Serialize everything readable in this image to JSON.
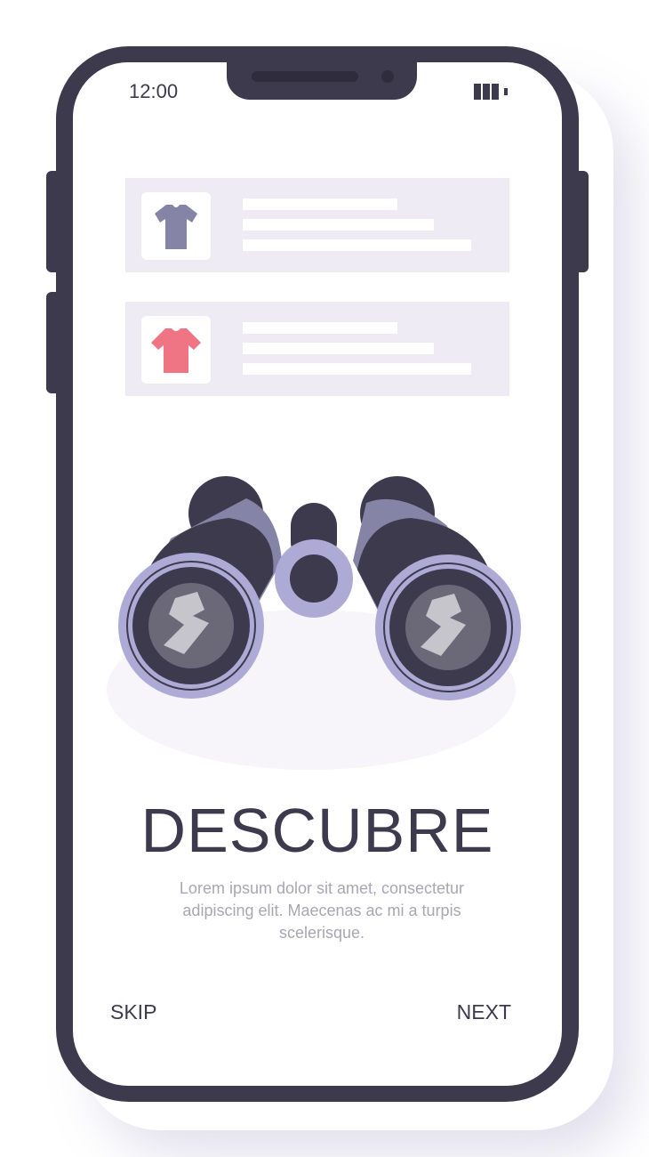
{
  "status_bar": {
    "time": "12:00",
    "battery_icon": "battery-icon"
  },
  "product_list": [
    {
      "icon": "tshirt-icon",
      "color": "#8583a6"
    },
    {
      "icon": "tshirt-icon",
      "color": "#ef7584"
    }
  ],
  "illustration": {
    "icon": "binoculars-icon"
  },
  "onboarding": {
    "title": "DESCUBRE",
    "description": "Lorem ipsum dolor sit amet, consectetur adipiscing elit. Maecenas ac mi a turpis scelerisque."
  },
  "navigation": {
    "skip_label": "SKIP",
    "next_label": "NEXT"
  },
  "colors": {
    "frame": "#3e3a4e",
    "card_bg": "#efebf4",
    "lens_ring": "#aeaad6",
    "muted_text": "#a9a6b3"
  }
}
